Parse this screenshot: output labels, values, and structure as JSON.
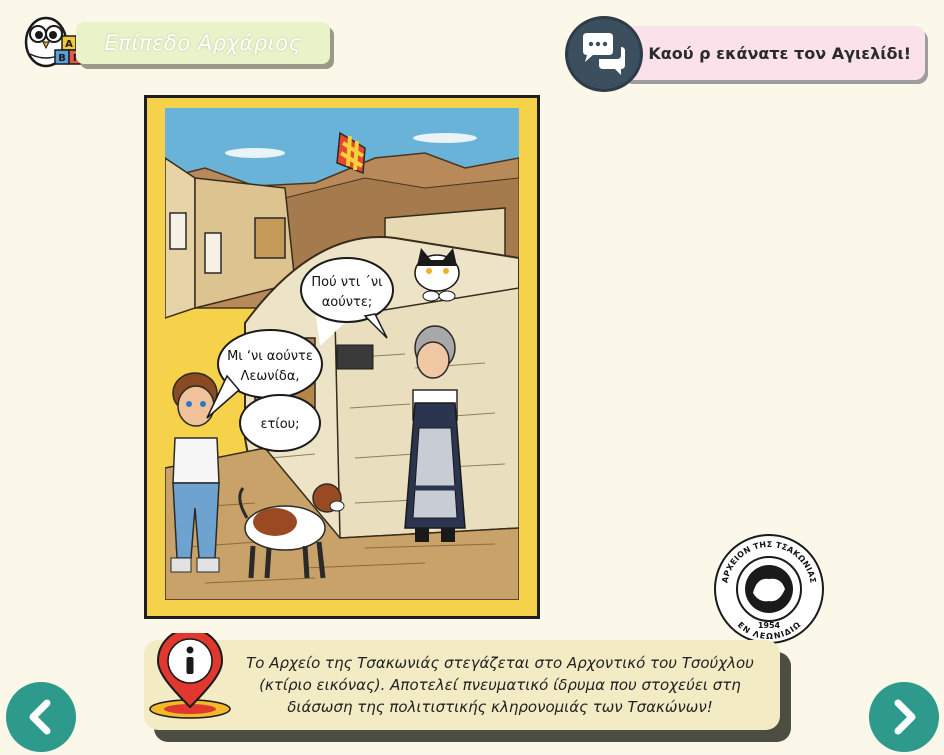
{
  "header": {
    "level_label": "Επίπεδο Αρχάριος",
    "owl_blocks": [
      "Α",
      "Β",
      "Γ"
    ]
  },
  "message": {
    "text": "Καού ρ εκάνατε τον Αγιελίδι!",
    "icon": "chat-bubbles-icon"
  },
  "scene": {
    "bubble_cat": [
      "Πού ντι ΄νι",
      "αούντε;"
    ],
    "bubble_boy_1": [
      "Μι ‘νι αούντε",
      "Λεωνίδα,"
    ],
    "bubble_boy_2": [
      "ετίου;"
    ]
  },
  "seal": {
    "top_text": "ΑΡΧΕΙΟΝ ΤΗΣ ΤΣΑΚΩΝΙΑΣ",
    "bottom_text": "ΕΝ ΛΕΩΝΙΔΙΩ",
    "year": "1954"
  },
  "info": {
    "icon": "info-pin-icon",
    "lines": [
      "Το Αρχείο της Τσακωνιάς στεγάζεται στο Αρχοντικό του Τσούχλου",
      "(κτίριο εικόνας). Αποτελεί πνευματικό ίδρυμα που στοχεύει στη",
      "διάσωση της πολιτιστικής κληρονομιάς των Τσακώνων!"
    ]
  },
  "nav": {
    "prev_icon": "chevron-left-icon",
    "next_icon": "chevron-right-icon"
  },
  "colors": {
    "background": "#fbf8e9",
    "frame": "#f6d24b",
    "nav": "#2e9a8c",
    "message_box": "#fbe2ea",
    "level_tag": "#eaf2c9"
  }
}
